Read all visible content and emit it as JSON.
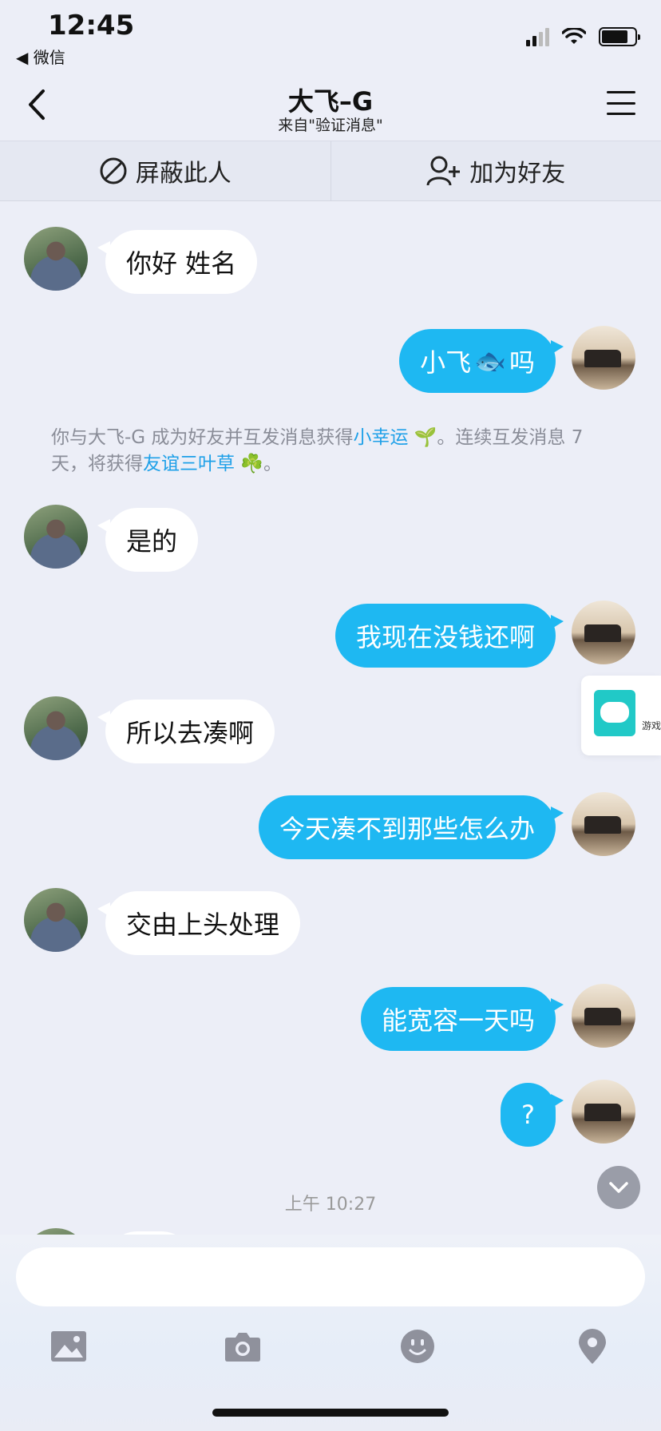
{
  "status_bar": {
    "time": "12:45",
    "back_app": "◀ 微信"
  },
  "nav": {
    "title": "大飞–G",
    "subtitle": "来自\"验证消息\""
  },
  "actions": {
    "block": "屏蔽此人",
    "add_friend": "加为好友"
  },
  "messages": [
    {
      "side": "in",
      "text": "你好 姓名"
    },
    {
      "side": "out",
      "text_before": "小飞",
      "emoji": "🐟",
      "text_after": "吗"
    },
    {
      "side": "in",
      "text": "是的"
    },
    {
      "side": "out",
      "text": "我现在没钱还啊"
    },
    {
      "side": "in",
      "text": "所以去凑啊"
    },
    {
      "side": "out",
      "text": "今天凑不到那些怎么办"
    },
    {
      "side": "in",
      "text": "交由上头处理"
    },
    {
      "side": "out",
      "text": "能宽容一天吗"
    },
    {
      "side": "out",
      "text": "?"
    }
  ],
  "system_message": {
    "part1": "你与大飞-G 成为好友并互发消息获得",
    "link1": "小幸运",
    "emoji1": "🌱",
    "part2": "。连续互发消息 7 天，将获得",
    "link2": "友谊三叶草",
    "emoji2": "☘️",
    "part3": "。"
  },
  "time_separator": "上午 10:27",
  "game_tab": {
    "label": "游戏",
    "icon": "gamepad-icon"
  },
  "toolbar": {
    "icons": [
      "image-icon",
      "camera-icon",
      "emoji-icon",
      "location-icon"
    ]
  },
  "colors": {
    "outgoing_bubble": "#1EB8F2",
    "link": "#1EA0E8",
    "background": "#ECEEF7"
  }
}
